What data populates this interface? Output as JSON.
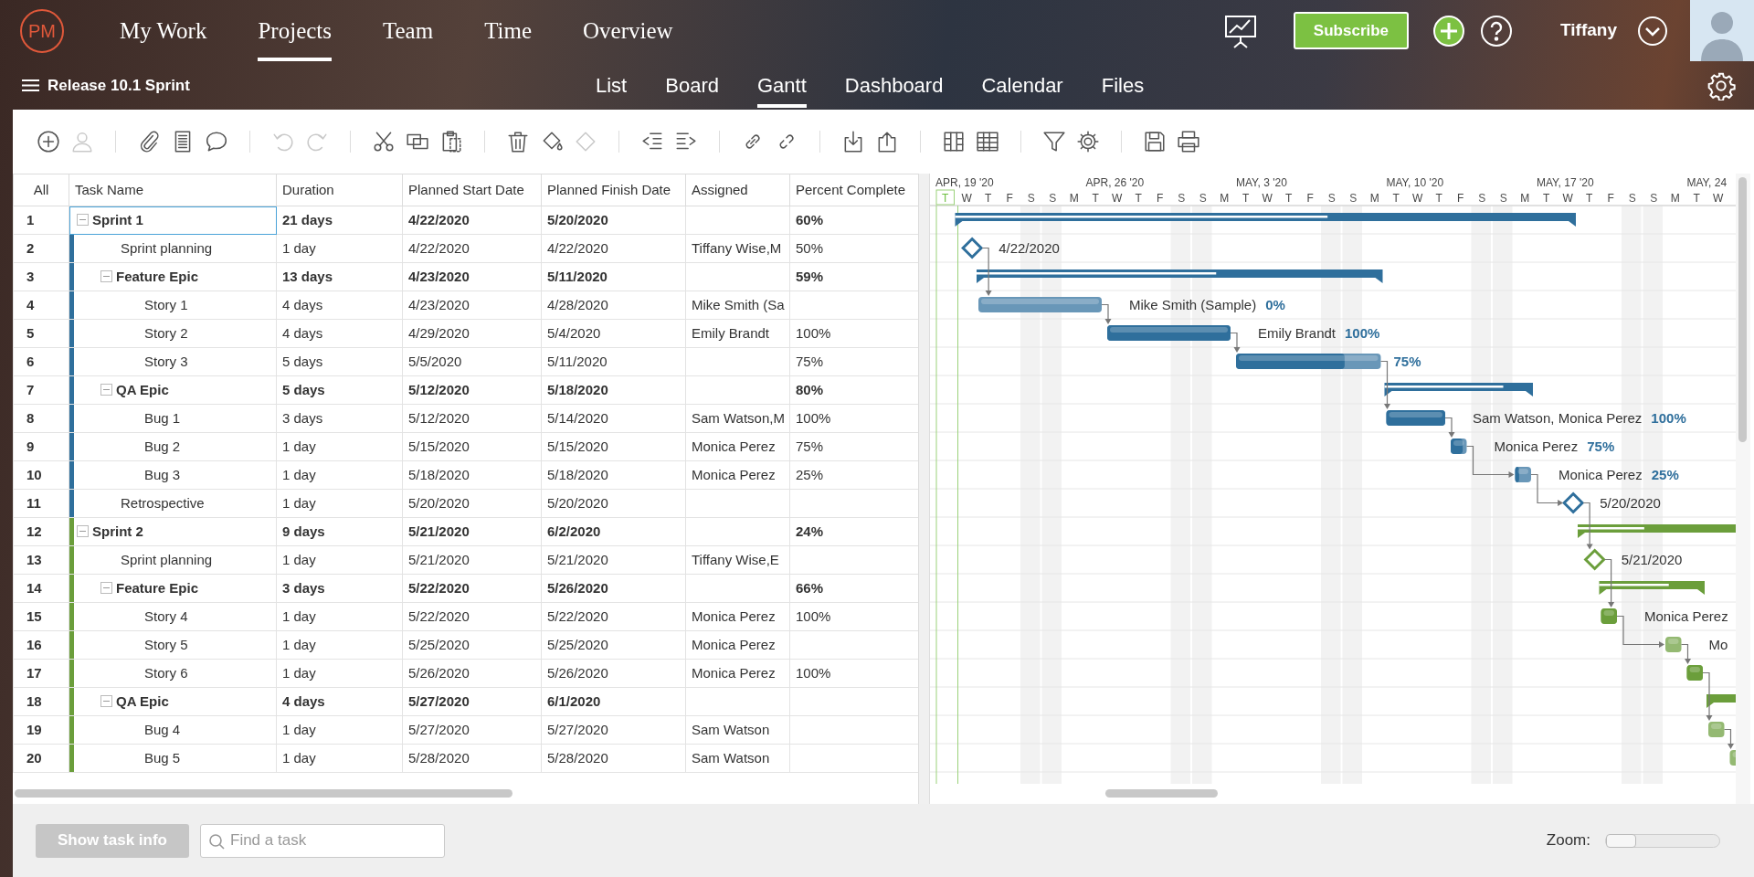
{
  "app": {
    "logo": "PM"
  },
  "main_nav": [
    {
      "label": "My Work",
      "selected": false
    },
    {
      "label": "Projects",
      "selected": true
    },
    {
      "label": "Team",
      "selected": false
    },
    {
      "label": "Time",
      "selected": false
    },
    {
      "label": "Overview",
      "selected": false
    }
  ],
  "subscribe_button": "Subscribe",
  "user": {
    "name": "Tiffany"
  },
  "project": {
    "title": "Release 10.1 Sprint"
  },
  "view_tabs": [
    {
      "label": "List",
      "selected": false
    },
    {
      "label": "Board",
      "selected": false
    },
    {
      "label": "Gantt",
      "selected": true
    },
    {
      "label": "Dashboard",
      "selected": false
    },
    {
      "label": "Calendar",
      "selected": false
    },
    {
      "label": "Files",
      "selected": false
    }
  ],
  "toolbar": [
    {
      "kind": "add",
      "disabled": false
    },
    {
      "kind": "user",
      "disabled": true
    },
    {
      "kind": "separator"
    },
    {
      "kind": "attach",
      "disabled": false
    },
    {
      "kind": "notes",
      "disabled": false
    },
    {
      "kind": "comment",
      "disabled": false
    },
    {
      "kind": "separator"
    },
    {
      "kind": "undo",
      "disabled": true
    },
    {
      "kind": "redo",
      "disabled": true
    },
    {
      "kind": "separator"
    },
    {
      "kind": "cut",
      "disabled": false
    },
    {
      "kind": "copy",
      "disabled": false
    },
    {
      "kind": "paste",
      "disabled": false
    },
    {
      "kind": "separator"
    },
    {
      "kind": "delete",
      "disabled": false
    },
    {
      "kind": "fill",
      "disabled": false
    },
    {
      "kind": "shape",
      "disabled": true
    },
    {
      "kind": "separator"
    },
    {
      "kind": "outdent",
      "disabled": false
    },
    {
      "kind": "indent",
      "disabled": false
    },
    {
      "kind": "separator"
    },
    {
      "kind": "link",
      "disabled": false
    },
    {
      "kind": "unlink",
      "disabled": false
    },
    {
      "kind": "separator"
    },
    {
      "kind": "import",
      "disabled": false
    },
    {
      "kind": "export",
      "disabled": false
    },
    {
      "kind": "separator"
    },
    {
      "kind": "columns",
      "disabled": false
    },
    {
      "kind": "grid",
      "disabled": false
    },
    {
      "kind": "separator"
    },
    {
      "kind": "filter",
      "disabled": false
    },
    {
      "kind": "settings",
      "disabled": false
    },
    {
      "kind": "separator"
    },
    {
      "kind": "save",
      "disabled": false
    },
    {
      "kind": "print",
      "disabled": false
    }
  ],
  "table": {
    "columns": [
      "All",
      "Task Name",
      "Duration",
      "Planned Start Date",
      "Planned Finish Date",
      "Assigned",
      "Percent Complete"
    ],
    "rows": [
      {
        "num": "1",
        "name": "Sprint 1",
        "kind": "summary",
        "duration": "21 days",
        "start": "4/22/2020",
        "finish": "5/20/2020",
        "percent": "60%",
        "selected": true,
        "expanded": true,
        "color": "#2f6f9c",
        "level": 0.6,
        "children": [
          {
            "num": "2",
            "name": "Sprint planning",
            "kind": "milestone",
            "duration": "1 day",
            "start": "4/22/2020",
            "finish": "4/22/2020",
            "assigned": "Tiffany Wise,M",
            "percent": "50%",
            "selected": false,
            "bar_label": "4/22/2020"
          },
          {
            "num": "3",
            "name": "Feature Epic",
            "kind": "summary",
            "duration": "13 days",
            "start": "4/23/2020",
            "finish": "5/11/2020",
            "percent": "59%",
            "selected": false,
            "expanded": true,
            "level": 0.59,
            "children": [
              {
                "num": "4",
                "name": "Story 1",
                "kind": "task",
                "duration": "4 days",
                "start": "4/23/2020",
                "finish": "4/28/2020",
                "assigned": "Mike Smith (Sa",
                "selected": false,
                "level": 0,
                "bar_label": "Mike Smith (Sample)",
                "bar_percent": "0%"
              },
              {
                "num": "5",
                "name": "Story 2",
                "kind": "task",
                "duration": "4 days",
                "start": "4/29/2020",
                "finish": "5/4/2020",
                "assigned": "Emily Brandt",
                "percent": "100%",
                "selected": false,
                "level": 1,
                "bar_label": "Emily Brandt",
                "bar_percent": "100%"
              },
              {
                "num": "6",
                "name": "Story 3",
                "kind": "task",
                "duration": "5 days",
                "start": "5/5/2020",
                "finish": "5/11/2020",
                "percent": "75%",
                "selected": false,
                "level": 0.75,
                "bar_percent": "75%"
              }
            ]
          },
          {
            "num": "7",
            "name": "QA Epic",
            "kind": "summary",
            "duration": "5 days",
            "start": "5/12/2020",
            "finish": "5/18/2020",
            "percent": "80%",
            "selected": false,
            "expanded": true,
            "level": 0.8,
            "children": [
              {
                "num": "8",
                "name": "Bug 1",
                "kind": "task",
                "duration": "3 days",
                "start": "5/12/2020",
                "finish": "5/14/2020",
                "assigned": "Sam Watson,M",
                "percent": "100%",
                "selected": false,
                "level": 1,
                "bar_label": "Sam Watson, Monica Perez",
                "bar_percent": "100%"
              },
              {
                "num": "9",
                "name": "Bug 2",
                "kind": "task",
                "duration": "1 day",
                "start": "5/15/2020",
                "finish": "5/15/2020",
                "assigned": "Monica Perez",
                "percent": "75%",
                "selected": false,
                "level": 0.75,
                "bar_label": "Monica Perez",
                "bar_percent": "75%"
              },
              {
                "num": "10",
                "name": "Bug 3",
                "kind": "task",
                "duration": "1 day",
                "start": "5/18/2020",
                "finish": "5/18/2020",
                "assigned": "Monica Perez",
                "percent": "25%",
                "selected": false,
                "level": 0.25,
                "bar_label": "Monica Perez",
                "bar_percent": "25%"
              }
            ]
          },
          {
            "num": "11",
            "name": "Retrospective",
            "kind": "milestone",
            "duration": "1 day",
            "start": "5/20/2020",
            "finish": "5/20/2020",
            "selected": false,
            "bar_label": "5/20/2020"
          }
        ]
      },
      {
        "num": "12",
        "name": "Sprint 2",
        "kind": "summary",
        "duration": "9 days",
        "start": "5/21/2020",
        "finish": "6/2/2020",
        "percent": "24%",
        "selected": false,
        "expanded": true,
        "color": "#6b9e3b",
        "level": 0.24,
        "children": [
          {
            "num": "13",
            "name": "Sprint planning",
            "kind": "milestone",
            "duration": "1 day",
            "start": "5/21/2020",
            "finish": "5/21/2020",
            "assigned": "Tiffany Wise,E",
            "selected": false,
            "bar_label": "5/21/2020"
          },
          {
            "num": "14",
            "name": "Feature Epic",
            "kind": "summary",
            "duration": "3 days",
            "start": "5/22/2020",
            "finish": "5/26/2020",
            "percent": "66%",
            "selected": false,
            "expanded": true,
            "level": 0.66,
            "children": [
              {
                "num": "15",
                "name": "Story 4",
                "kind": "task",
                "duration": "1 day",
                "start": "5/22/2020",
                "finish": "5/22/2020",
                "assigned": "Monica Perez",
                "percent": "100%",
                "selected": false,
                "level": 1,
                "bar_label": "Monica Perez"
              },
              {
                "num": "16",
                "name": "Story 5",
                "kind": "task",
                "duration": "1 day",
                "start": "5/25/2020",
                "finish": "5/25/2020",
                "assigned": "Monica Perez",
                "selected": false,
                "level": 0,
                "bar_label": "Mo"
              },
              {
                "num": "17",
                "name": "Story 6",
                "kind": "task",
                "duration": "1 day",
                "start": "5/26/2020",
                "finish": "5/26/2020",
                "assigned": "Monica Perez",
                "percent": "100%",
                "selected": false,
                "level": 1
              }
            ]
          },
          {
            "num": "18",
            "name": "QA Epic",
            "kind": "summary",
            "duration": "4 days",
            "start": "5/27/2020",
            "finish": "6/1/2020",
            "selected": false,
            "expanded": true,
            "level": 0,
            "children": [
              {
                "num": "19",
                "name": "Bug 4",
                "kind": "task",
                "duration": "1 day",
                "start": "5/27/2020",
                "finish": "5/27/2020",
                "assigned": "Sam Watson",
                "selected": false,
                "level": 0
              },
              {
                "num": "20",
                "name": "Bug 5",
                "kind": "task",
                "duration": "1 day",
                "start": "5/28/2020",
                "finish": "5/28/2020",
                "assigned": "Sam Watson",
                "selected": false,
                "level": 0
              }
            ]
          }
        ]
      }
    ]
  },
  "gantt": {
    "weeks": [
      "APR, 19 '20",
      "APR, 26 '20",
      "MAY, 3 '20",
      "MAY, 10 '20",
      "MAY, 17 '20",
      "MAY, 24"
    ],
    "days": [
      {
        "label": "T",
        "today": true,
        "weekend": false
      },
      {
        "label": "W",
        "today": false,
        "weekend": false
      },
      {
        "label": "T",
        "today": false,
        "weekend": false
      },
      {
        "label": "F",
        "today": false,
        "weekend": false
      },
      {
        "label": "S",
        "today": false,
        "weekend": true
      },
      {
        "label": "S",
        "today": false,
        "weekend": true
      },
      {
        "label": "M",
        "today": false,
        "weekend": false
      },
      {
        "label": "T",
        "today": false,
        "weekend": false
      },
      {
        "label": "W",
        "today": false,
        "weekend": false
      },
      {
        "label": "T",
        "today": false,
        "weekend": false
      },
      {
        "label": "F",
        "today": false,
        "weekend": false
      },
      {
        "label": "S",
        "today": false,
        "weekend": true
      },
      {
        "label": "S",
        "today": false,
        "weekend": true
      },
      {
        "label": "M",
        "today": false,
        "weekend": false
      },
      {
        "label": "T",
        "today": false,
        "weekend": false
      },
      {
        "label": "W",
        "today": false,
        "weekend": false
      },
      {
        "label": "T",
        "today": false,
        "weekend": false
      },
      {
        "label": "F",
        "today": false,
        "weekend": false
      },
      {
        "label": "S",
        "today": false,
        "weekend": true
      },
      {
        "label": "S",
        "today": false,
        "weekend": true
      },
      {
        "label": "M",
        "today": false,
        "weekend": false
      },
      {
        "label": "T",
        "today": false,
        "weekend": false
      },
      {
        "label": "W",
        "today": false,
        "weekend": false
      },
      {
        "label": "T",
        "today": false,
        "weekend": false
      },
      {
        "label": "F",
        "today": false,
        "weekend": false
      },
      {
        "label": "S",
        "today": false,
        "weekend": true
      },
      {
        "label": "S",
        "today": false,
        "weekend": true
      },
      {
        "label": "M",
        "today": false,
        "weekend": false
      },
      {
        "label": "T",
        "today": false,
        "weekend": false
      },
      {
        "label": "W",
        "today": false,
        "weekend": false
      },
      {
        "label": "T",
        "today": false,
        "weekend": false
      },
      {
        "label": "F",
        "today": false,
        "weekend": false
      },
      {
        "label": "S",
        "today": false,
        "weekend": true
      },
      {
        "label": "S",
        "today": false,
        "weekend": true
      },
      {
        "label": "M",
        "today": false,
        "weekend": false
      },
      {
        "label": "T",
        "today": false,
        "weekend": false
      },
      {
        "label": "W",
        "today": false,
        "weekend": false
      }
    ]
  },
  "footer": {
    "task_info_button": {
      "label": "Show task info",
      "disabled": true
    },
    "search": {
      "placeholder": "Find a task"
    },
    "zoom": {
      "label": "Zoom:",
      "level": 0
    }
  }
}
